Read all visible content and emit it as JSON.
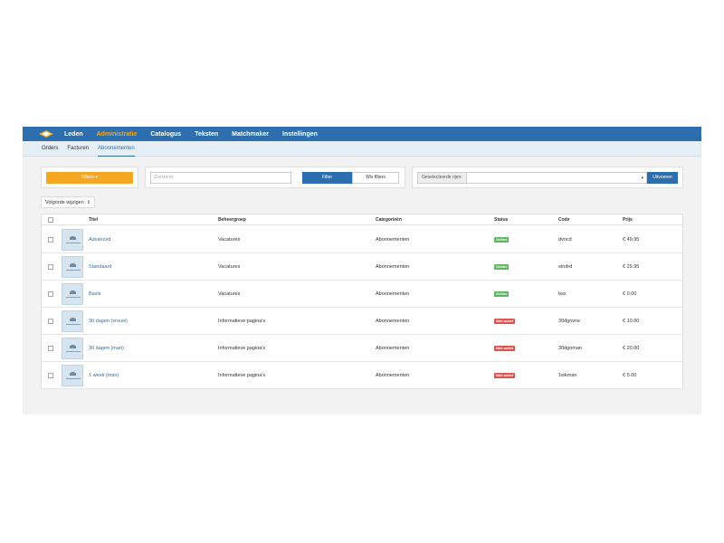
{
  "nav": {
    "items": [
      {
        "label": "Leden",
        "active": false
      },
      {
        "label": "Administratie",
        "active": true
      },
      {
        "label": "Catalogus",
        "active": false
      },
      {
        "label": "Teksten",
        "active": false
      },
      {
        "label": "Matchmaker",
        "active": false
      },
      {
        "label": "Instellingen",
        "active": false
      }
    ]
  },
  "subnav": {
    "items": [
      {
        "label": "Orders",
        "active": false
      },
      {
        "label": "Facturen",
        "active": false
      },
      {
        "label": "Abonnementen",
        "active": true
      }
    ]
  },
  "toolbar": {
    "filters_label": "Filters ▾",
    "search_placeholder": "Zoekterm",
    "filter_label": "Filter",
    "clear_label": "Wis filters",
    "selected_label": "Geselecteerde rijen:",
    "run_label": "Uitvoeren"
  },
  "order_button": {
    "label": "Volgorde wijzigen",
    "icon": "sort-icon"
  },
  "table": {
    "headers": [
      "Titel",
      "Beheergroep",
      "Categorieën",
      "Status",
      "Code",
      "Prijs"
    ],
    "rows": [
      {
        "title": "Advanced",
        "group": "Vacatures",
        "category": "Abonnementen",
        "status": "Online",
        "code": "dvncd",
        "price": "€ 49.95"
      },
      {
        "title": "Standaard",
        "group": "Vacatures",
        "category": "Abonnementen",
        "status": "Online",
        "code": "stndrd",
        "price": "€ 29.95"
      },
      {
        "title": "Basis",
        "group": "Vacatures",
        "category": "Abonnementen",
        "status": "Online",
        "code": "bss",
        "price": "€ 0.00"
      },
      {
        "title": "30 dagen (vrouw)",
        "group": "Informatieve pagina's",
        "category": "Abonnementen",
        "status": "Niet actief",
        "code": "30dgnvrw",
        "price": "€ 10.00"
      },
      {
        "title": "30 dagen (man)",
        "group": "Informatieve pagina's",
        "category": "Abonnementen",
        "status": "Niet actief",
        "code": "30dgnman",
        "price": "€ 20.00"
      },
      {
        "title": "1 week (man)",
        "group": "Informatieve pagina's",
        "category": "Abonnementen",
        "status": "Niet actief",
        "code": "1wkman",
        "price": "€ 5.00"
      }
    ]
  },
  "colors": {
    "primary": "#2d6fae",
    "accent": "#f5a623",
    "online": "#5cb85c",
    "inactive": "#d9534f"
  }
}
